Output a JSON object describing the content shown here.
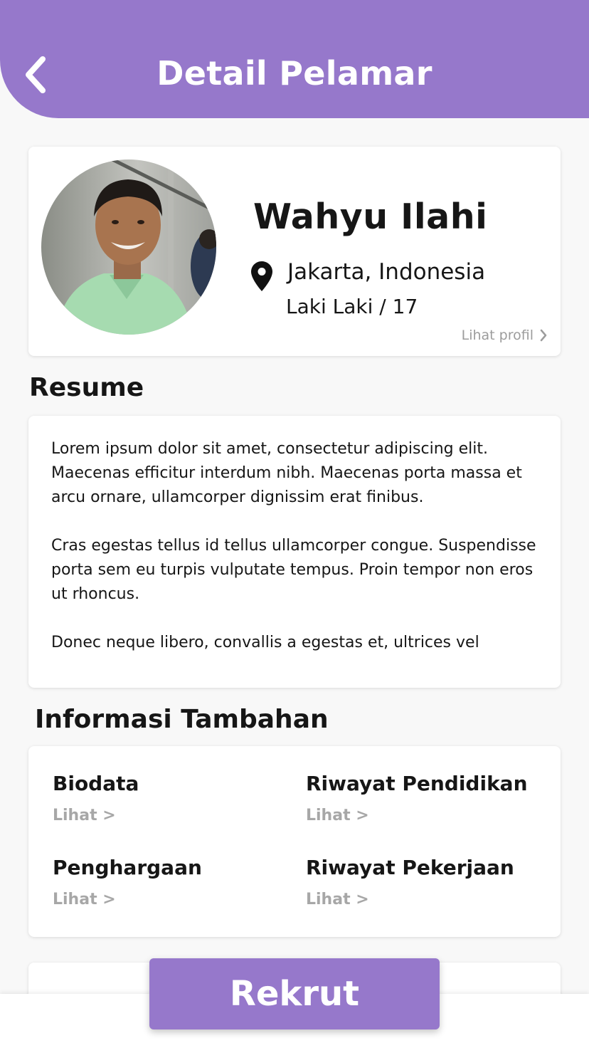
{
  "header": {
    "title": "Detail Pelamar",
    "back_icon": "chevron-left-icon"
  },
  "profile": {
    "name": "Wahyu Ilahi",
    "location": "Jakarta, Indonesia",
    "gender_age": "Laki Laki / 17",
    "view_profile_label": "Lihat profil",
    "location_icon": "map-pin-icon"
  },
  "resume": {
    "title": "Resume",
    "paragraphs": [
      "Lorem ipsum dolor sit amet, consectetur adipiscing elit. Maecenas efficitur interdum nibh. Maecenas porta massa et arcu ornare, ullamcorper dignissim erat finibus.",
      "Cras egestas tellus id tellus ullamcorper congue. Suspendisse porta sem eu turpis vulputate tempus. Proin tempor non eros ut rhoncus.",
      "Donec neque libero, convallis a egestas et, ultrices vel"
    ]
  },
  "additional_info": {
    "title": "Informasi Tambahan",
    "items": [
      {
        "label": "Biodata",
        "link": "Lihat >"
      },
      {
        "label": "Riwayat Pendidikan",
        "link": "Lihat >"
      },
      {
        "label": "Penghargaan",
        "link": "Lihat >"
      },
      {
        "label": "Riwayat Pekerjaan",
        "link": "Lihat >"
      }
    ]
  },
  "actions": {
    "recruit_label": "Rekrut"
  },
  "colors": {
    "primary": "#9678cb",
    "background": "#f8f8f8",
    "card": "#ffffff",
    "muted_text": "#a7a7a7"
  }
}
